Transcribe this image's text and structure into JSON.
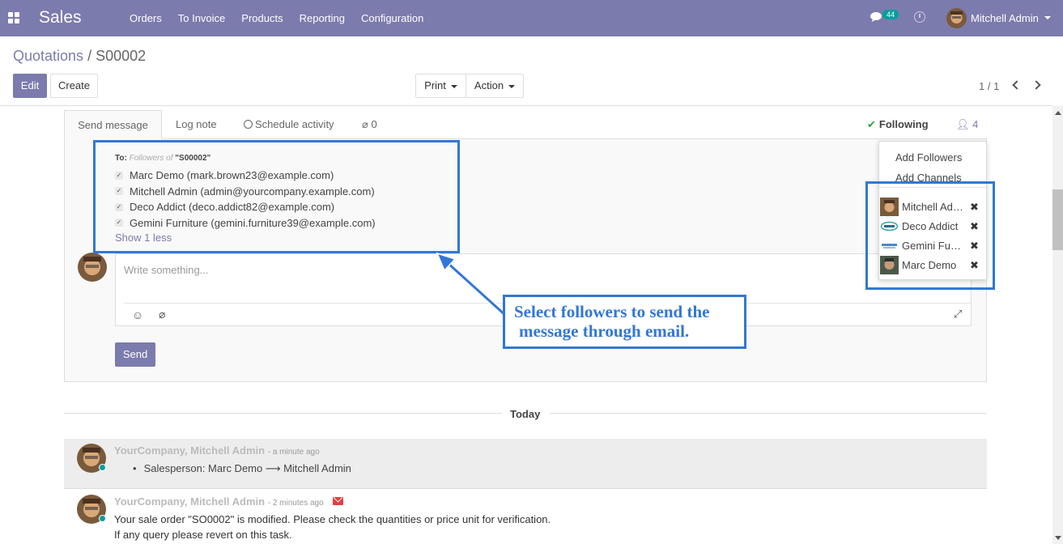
{
  "topbar": {
    "app_name": "Sales",
    "menu": [
      "Orders",
      "To Invoice",
      "Products",
      "Reporting",
      "Configuration"
    ],
    "chat_count": "44",
    "user_name": "Mitchell Admin"
  },
  "breadcrumb": {
    "parent": "Quotations",
    "separator": "/",
    "current": "S00002"
  },
  "buttons": {
    "edit": "Edit",
    "create": "Create",
    "print": "Print",
    "action": "Action"
  },
  "pager": {
    "text": "1 / 1"
  },
  "chatter": {
    "tabs": {
      "send_message": "Send message",
      "log_note": "Log note",
      "schedule_activity": "Schedule activity",
      "attachments": "0"
    },
    "following": "Following",
    "follower_count": "4",
    "to_label": "To:",
    "to_hint": "Followers of",
    "to_record": "\"S00002\"",
    "recipients": [
      "Marc Demo (mark.brown23@example.com)",
      "Mitchell Admin (admin@yourcompany.example.com)",
      "Deco Addict (deco.addict82@example.com)",
      "Gemini Furniture (gemini.furniture39@example.com)"
    ],
    "show_less": "Show 1 less",
    "placeholder": "Write something...",
    "send": "Send"
  },
  "followers_dropdown": {
    "add_followers": "Add Followers",
    "add_channels": "Add Channels",
    "followers": [
      "Mitchell Admin",
      "Deco Addict",
      "Gemini Furniture",
      "Marc Demo"
    ]
  },
  "callout": {
    "line1": "Select followers to send the",
    "line2": "message through email."
  },
  "thread": {
    "separator": "Today",
    "messages": [
      {
        "author": "YourCompany, Mitchell Admin",
        "time": "- a minute ago",
        "change": "Salesperson: Marc Demo ⟶ Mitchell Admin"
      },
      {
        "author": "YourCompany, Mitchell Admin",
        "time": "- 2 minutes ago",
        "line1": "Your sale order \"SO0002\" is modified. Please check the quantities or price unit for verification.",
        "line2": "If any query please revert on this task."
      }
    ]
  },
  "colors": {
    "brand": "#7c7bad",
    "highlight": "#3277d6",
    "online": "#00a09d",
    "following_check": "#28a745"
  }
}
